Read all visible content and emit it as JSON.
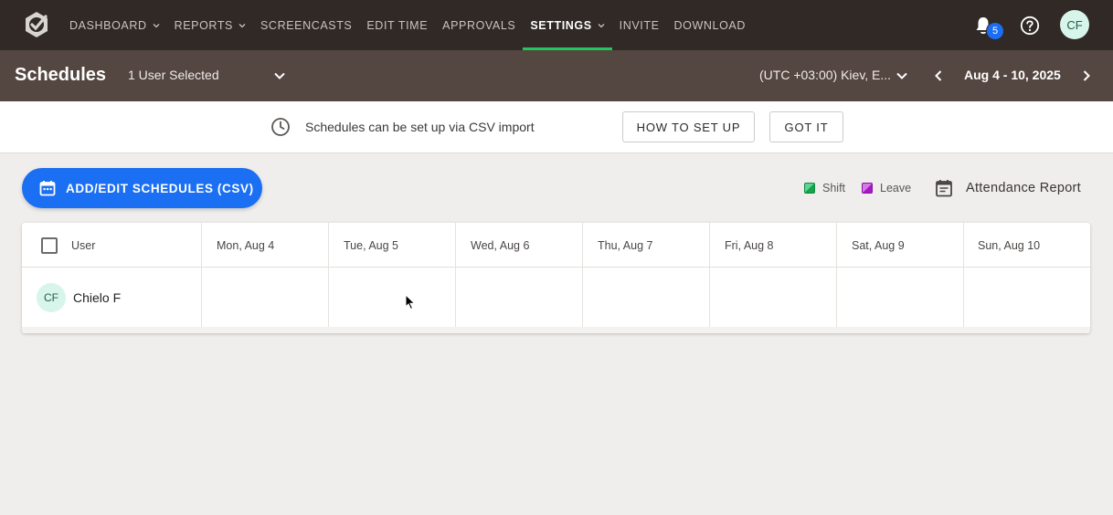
{
  "nav": {
    "items": [
      {
        "label": "DASHBOARD",
        "has_menu": true
      },
      {
        "label": "REPORTS",
        "has_menu": true
      },
      {
        "label": "SCREENCASTS",
        "has_menu": false
      },
      {
        "label": "EDIT TIME",
        "has_menu": false
      },
      {
        "label": "APPROVALS",
        "has_menu": false
      },
      {
        "label": "SETTINGS",
        "has_menu": true,
        "active": true
      },
      {
        "label": "INVITE",
        "has_menu": false
      },
      {
        "label": "DOWNLOAD",
        "has_menu": false
      }
    ],
    "notification_count": "5",
    "avatar_initials": "CF",
    "active_color": "#22c55e"
  },
  "subheader": {
    "title": "Schedules",
    "user_select": "1 User Selected",
    "timezone": "(UTC +03:00) Kiev, E...",
    "date_range": "Aug 4 - 10, 2025"
  },
  "banner": {
    "text": "Schedules can be set up via CSV import",
    "how_label": "HOW TO SET UP",
    "got_label": "GOT IT"
  },
  "toolbar": {
    "add_label": "ADD/EDIT SCHEDULES (CSV)",
    "legend_shift": "Shift",
    "legend_leave": "Leave",
    "attendance_label": "Attendance Report",
    "accent": "#1a6ff2"
  },
  "table": {
    "user_header": "User",
    "days": [
      "Mon, Aug 4",
      "Tue, Aug 5",
      "Wed, Aug 6",
      "Thu, Aug 7",
      "Fri, Aug 8",
      "Sat, Aug 9",
      "Sun, Aug 10"
    ],
    "rows": [
      {
        "initials": "CF",
        "name": "Chielo F"
      }
    ]
  }
}
